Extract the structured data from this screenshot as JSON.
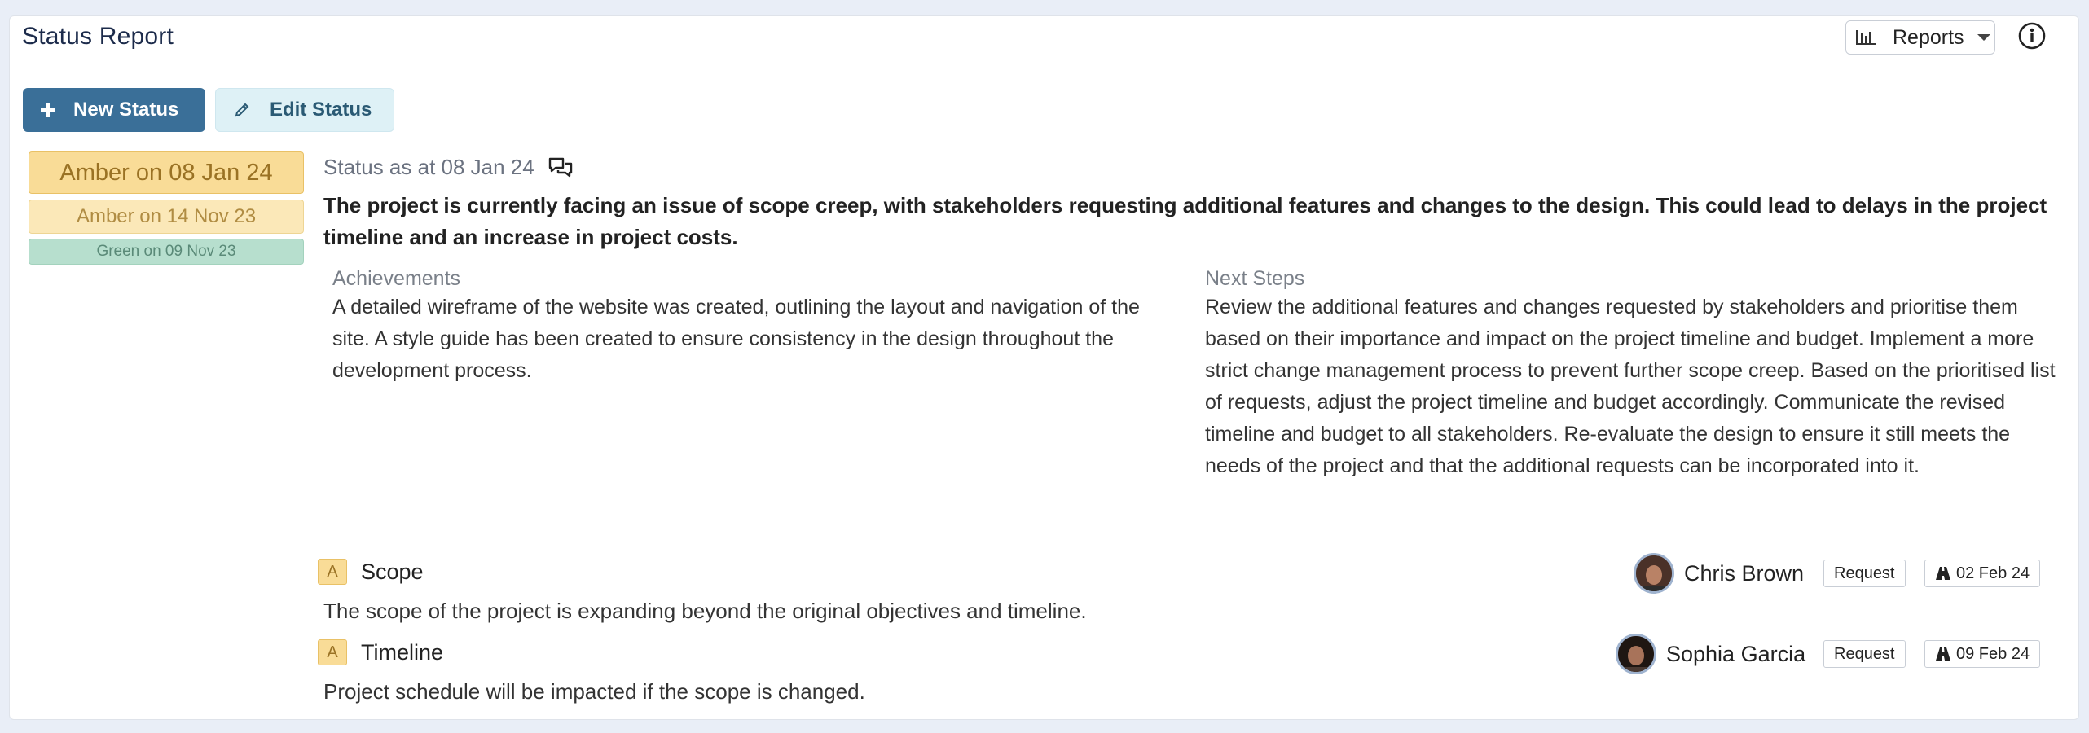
{
  "header": {
    "title": "Status Report",
    "reports_label": "Reports"
  },
  "actions": {
    "new_status": "New Status",
    "edit_status": "Edit Status"
  },
  "history": [
    {
      "label": "Amber on 08 Jan 24",
      "color": "#f9dc97"
    },
    {
      "label": "Amber on 14 Nov 23",
      "color": "#fbe8b8"
    },
    {
      "label": "Green on 09 Nov 23",
      "color": "#b7dfce"
    }
  ],
  "status": {
    "as_at": "Status as at 08 Jan 24",
    "summary": "The project is currently facing an issue of scope creep, with stakeholders requesting additional features and changes to the design. This could lead to delays in the project timeline and an increase in project costs.",
    "achievements_label": "Achievements",
    "achievements": "A detailed wireframe of the website was created, outlining the layout and navigation of the site. A style guide has been created to ensure consistency in the design throughout the development process.",
    "next_steps_label": "Next Steps",
    "next_steps": "Review the additional features and changes requested by stakeholders and prioritise them based on their importance and impact on the project timeline and budget. Implement a more strict change management process to prevent further scope creep. Based on the prioritised list of requests, adjust the project timeline and budget accordingly. Communicate the revised timeline and budget to all stakeholders. Re-evaluate the design to ensure it still meets the needs of the project and that the additional requests can be incorporated into it."
  },
  "risks": [
    {
      "rating": "A",
      "title": "Scope",
      "description": "The scope of the project is expanding beyond the original objectives and timeline.",
      "owner": "Chris Brown",
      "type": "Request",
      "date": "02 Feb 24"
    },
    {
      "rating": "A",
      "title": "Timeline",
      "description": "Project schedule will be impacted if the scope is changed.",
      "owner": "Sophia Garcia",
      "type": "Request",
      "date": "09 Feb 24"
    }
  ],
  "colors": {
    "primary": "#3a6f98",
    "amber": "#f9dc97",
    "green": "#b7dfce"
  }
}
